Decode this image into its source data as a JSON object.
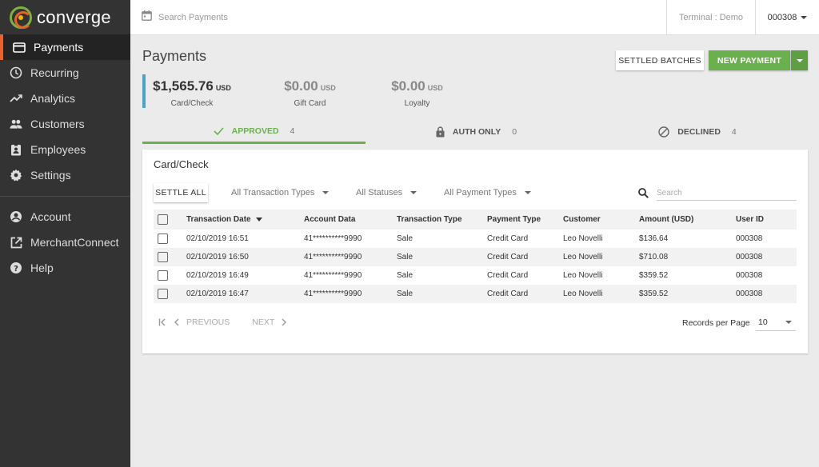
{
  "app": {
    "logo_text": "converge"
  },
  "sidebar": {
    "items": [
      {
        "label": "Payments",
        "icon": "credit-card-icon",
        "active": true
      },
      {
        "label": "Recurring",
        "icon": "clock-icon"
      },
      {
        "label": "Analytics",
        "icon": "trending-up-icon"
      },
      {
        "label": "Customers",
        "icon": "people-icon"
      },
      {
        "label": "Employees",
        "icon": "badge-icon"
      },
      {
        "label": "Settings",
        "icon": "gear-icon"
      }
    ],
    "secondary": [
      {
        "label": "Account",
        "icon": "account-circle-icon"
      },
      {
        "label": "MerchantConnect",
        "icon": "external-link-icon"
      },
      {
        "label": "Help",
        "icon": "help-icon"
      }
    ]
  },
  "topbar": {
    "search_placeholder": "Search Payments",
    "terminal": "Terminal : Demo",
    "user_id": "000308"
  },
  "main": {
    "title": "Payments",
    "settled_batches_label": "SETTLED BATCHES",
    "new_payment_label": "NEW PAYMENT",
    "summary": [
      {
        "amount": "$1,565.76",
        "currency": "USD",
        "label": "Card/Check"
      },
      {
        "amount": "$0.00",
        "currency": "USD",
        "label": "Gift Card"
      },
      {
        "amount": "$0.00",
        "currency": "USD",
        "label": "Loyalty"
      }
    ],
    "tabs": [
      {
        "label": "APPROVED",
        "count": "4",
        "icon": "check-icon",
        "active": true
      },
      {
        "label": "AUTH ONLY",
        "count": "0",
        "icon": "lock-icon"
      },
      {
        "label": "DECLINED",
        "count": "4",
        "icon": "block-icon"
      }
    ]
  },
  "card": {
    "title": "Card/Check",
    "settle_all_label": "SETTLE ALL",
    "filters": [
      "All Transaction Types",
      "All Statuses",
      "All Payment Types"
    ],
    "search_placeholder": "Search",
    "columns": [
      "Transaction Date",
      "Account Data",
      "Transaction Type",
      "Payment Type",
      "Customer",
      "Amount (USD)",
      "User ID"
    ],
    "rows": [
      [
        "02/10/2019 16:51",
        "41**********9990",
        "Sale",
        "Credit Card",
        "Leo Novelli",
        "$136.64",
        "000308"
      ],
      [
        "02/10/2019 16:50",
        "41**********9990",
        "Sale",
        "Credit Card",
        "Leo Novelli",
        "$710.08",
        "000308"
      ],
      [
        "02/10/2019 16:49",
        "41**********9990",
        "Sale",
        "Credit Card",
        "Leo Novelli",
        "$359.52",
        "000308"
      ],
      [
        "02/10/2019 16:47",
        "41**********9990",
        "Sale",
        "Credit Card",
        "Leo Novelli",
        "$359.52",
        "000308"
      ]
    ],
    "pagination": {
      "previous_label": "PREVIOUS",
      "next_label": "NEXT",
      "records_per_page_label": "Records per Page",
      "records_per_page_value": "10"
    }
  },
  "colors": {
    "sidebar_bg": "#333333",
    "active_accent": "#e8622a",
    "primary_green": "#6ab04c",
    "summary_accent": "#4aa3c6"
  }
}
